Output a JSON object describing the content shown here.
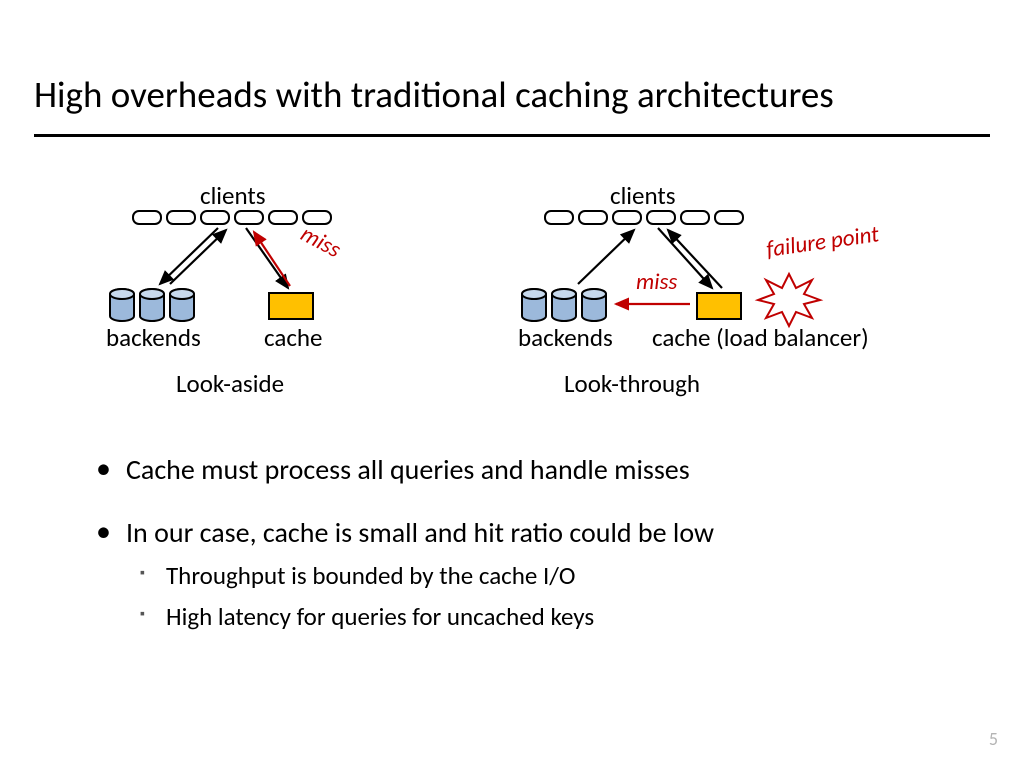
{
  "title": "High overheads with traditional caching architectures",
  "left": {
    "clients_label": "clients",
    "backends_label": "backends",
    "cache_label": "cache",
    "caption": "Look-aside",
    "miss": "miss"
  },
  "right": {
    "clients_label": "clients",
    "backends_label": "backends",
    "cache_label": "cache (load balancer)",
    "caption": "Look-through",
    "miss": "miss",
    "failure": "failure point"
  },
  "bullets": {
    "b1": "Cache must process all queries and handle misses",
    "b2": "In our case, cache is small and hit ratio could be low",
    "b2a": "Throughput is bounded by the cache I/O",
    "b2b": "High latency for queries for uncached keys"
  },
  "page": "5"
}
